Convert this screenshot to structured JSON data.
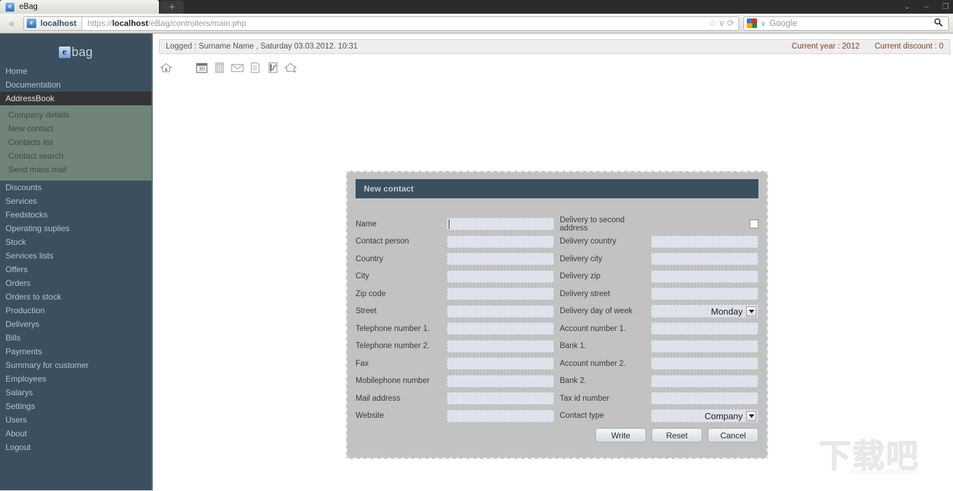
{
  "browser": {
    "tab": {
      "title": "eBag",
      "favicon": "e"
    },
    "new_tab_label": "+",
    "window_controls": {
      "minimize": "–",
      "maximize": "❐",
      "menu": "⌄"
    },
    "back_icon": "«",
    "site_identity": "localhost",
    "url_prefix": "https://",
    "url_host": "localhost",
    "url_path": "/eBag/controllers/main.php",
    "url_full": "https://localhost/eBag/controllers/main.php",
    "star_icon": "☆",
    "dropdown_icon": "∨",
    "reload_icon": "⟳",
    "search_engine": "Google",
    "search_placeholder": "Google",
    "search_icon": "search-icon"
  },
  "sidebar": {
    "brand_mark": "e",
    "brand_text": "bag",
    "items": [
      {
        "label": "Home",
        "active": false
      },
      {
        "label": "Documentation",
        "active": false
      },
      {
        "label": "AddressBook",
        "active": true
      },
      {
        "label": "Discounts",
        "active": false
      },
      {
        "label": "Services",
        "active": false
      },
      {
        "label": "Feedstocks",
        "active": false
      },
      {
        "label": "Operating suplies",
        "active": false
      },
      {
        "label": "Stock",
        "active": false
      },
      {
        "label": "Services lists",
        "active": false
      },
      {
        "label": "Offers",
        "active": false
      },
      {
        "label": "Orders",
        "active": false
      },
      {
        "label": "Orders to stock",
        "active": false
      },
      {
        "label": "Production",
        "active": false
      },
      {
        "label": "Deliverys",
        "active": false
      },
      {
        "label": "Bills",
        "active": false
      },
      {
        "label": "Payments",
        "active": false
      },
      {
        "label": "Summary for customer",
        "active": false
      },
      {
        "label": "Employees",
        "active": false
      },
      {
        "label": "Salarys",
        "active": false
      },
      {
        "label": "Settings",
        "active": false
      },
      {
        "label": "Users",
        "active": false
      },
      {
        "label": "About",
        "active": false
      },
      {
        "label": "Logout",
        "active": false
      }
    ],
    "submenu": [
      {
        "label": "Company details"
      },
      {
        "label": "New contact"
      },
      {
        "label": "Contacts list"
      },
      {
        "label": "Contact search"
      },
      {
        "label": "Send mass mail"
      }
    ]
  },
  "status_bar": {
    "logged_text": "Logged :  Surname Name  ,  Saturday 03.03.2012. 10:31",
    "current_year_label": "Current year :",
    "current_year_value": "2012",
    "current_discount_label": "Current discount :",
    "current_discount_value": "0"
  },
  "toolbar": {
    "icons": [
      {
        "name": "home-icon"
      },
      {
        "name": "calendar-icon",
        "text": "30"
      },
      {
        "name": "calculator-icon"
      },
      {
        "name": "mail-icon"
      },
      {
        "name": "notes-icon"
      },
      {
        "name": "chart-icon"
      },
      {
        "name": "home-exit-icon"
      }
    ]
  },
  "modal": {
    "title": "New contact",
    "left_fields": [
      {
        "label": "Name",
        "value": "",
        "type": "text",
        "focused": true
      },
      {
        "label": "Contact person",
        "value": "",
        "type": "text"
      },
      {
        "label": "Country",
        "value": "",
        "type": "text"
      },
      {
        "label": "City",
        "value": "",
        "type": "text"
      },
      {
        "label": "Zip code",
        "value": "",
        "type": "text"
      },
      {
        "label": "Street",
        "value": "",
        "type": "text"
      },
      {
        "label": "Telephone number 1.",
        "value": "",
        "type": "text"
      },
      {
        "label": "Telephone number 2.",
        "value": "",
        "type": "text"
      },
      {
        "label": "Fax",
        "value": "",
        "type": "text"
      },
      {
        "label": "Mobilephone number",
        "value": "",
        "type": "text"
      },
      {
        "label": "Mail address",
        "value": "",
        "type": "text"
      },
      {
        "label": "Website",
        "value": "",
        "type": "text"
      }
    ],
    "right_fields": [
      {
        "label": "Delivery to second address",
        "type": "checkbox",
        "checked": false
      },
      {
        "label": "Delivery country",
        "value": "",
        "type": "text"
      },
      {
        "label": "Delivery city",
        "value": "",
        "type": "text"
      },
      {
        "label": "Delivery zip",
        "value": "",
        "type": "text"
      },
      {
        "label": "Delivery street",
        "value": "",
        "type": "text"
      },
      {
        "label": "Delivery day of week",
        "value": "Monday",
        "type": "select"
      },
      {
        "label": "Account number 1.",
        "value": "",
        "type": "text"
      },
      {
        "label": "Bank 1.",
        "value": "",
        "type": "text"
      },
      {
        "label": "Account number 2.",
        "value": "",
        "type": "text"
      },
      {
        "label": "Bank 2.",
        "value": "",
        "type": "text"
      },
      {
        "label": "Tax id number",
        "value": "",
        "type": "text"
      },
      {
        "label": "Contact type",
        "value": "Company",
        "type": "select"
      }
    ],
    "buttons": [
      {
        "label": "Write",
        "name": "write-button"
      },
      {
        "label": "Reset",
        "name": "reset-button"
      },
      {
        "label": "Cancel",
        "name": "cancel-button"
      }
    ]
  },
  "watermark": {
    "text": "下载吧",
    "url": "www.xiazaiba.com"
  },
  "colors": {
    "sidebar_bg": "#3b4f5e",
    "sidebar_active": "#343434",
    "submenu_bg": "#71847a",
    "modal_bg": "#c2c2c2",
    "modal_title_bg": "#3b4f5e",
    "input_bg": "#dfe2ea",
    "accent_text": "#8b3a2a"
  }
}
